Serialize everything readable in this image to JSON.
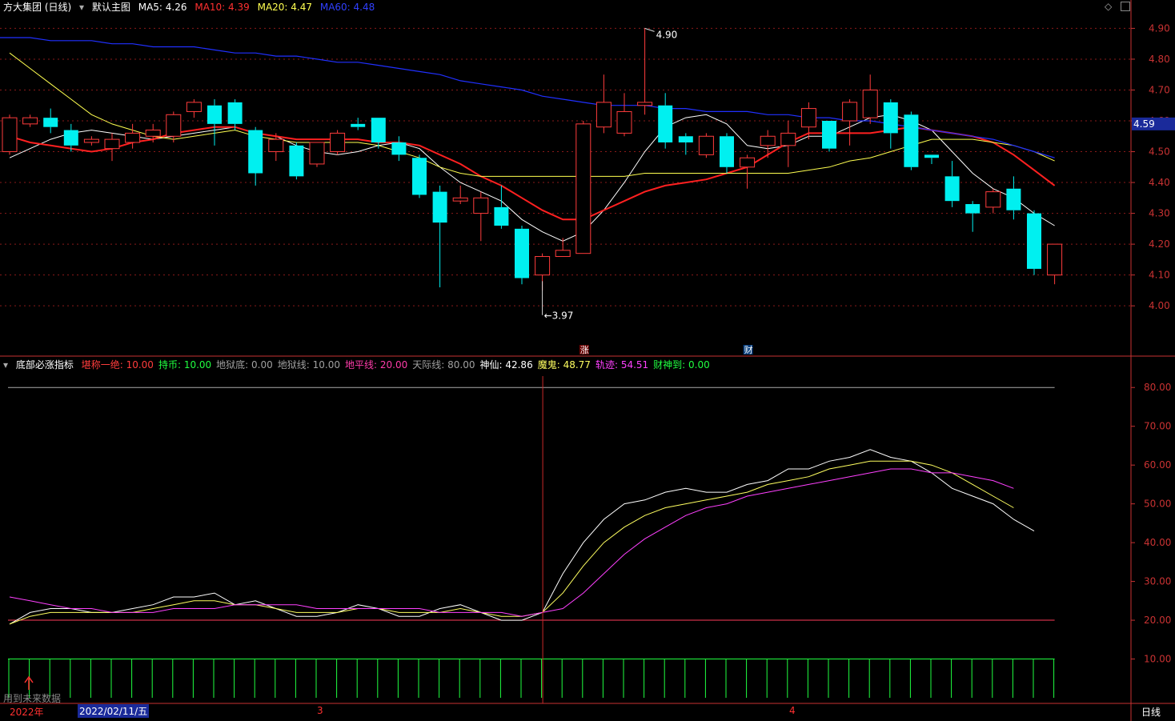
{
  "colors": {
    "bg": "#000000",
    "grid": "#8a1a1a",
    "axis_text": "#c83232",
    "up": "#ff3c3c",
    "down": "#00f0f0",
    "ma5": "#ffffff",
    "ma10": "#ff2020",
    "ma20": "#ffff50",
    "ma60": "#2030ff",
    "shenxian": "#ffffff",
    "mogui": "#ffff60",
    "guiji": "#ff40ff",
    "dipingxian": "#ff3c5a",
    "bars": "#20ff40"
  },
  "header": {
    "stock": "方大集团 (日线)",
    "main_chart": "默认主图",
    "ma5_label": "MA5:",
    "ma5_value": "4.26",
    "ma10_label": "MA10:",
    "ma10_value": "4.39",
    "ma20_label": "MA20:",
    "ma20_value": "4.47",
    "ma60_label": "MA60:",
    "ma60_value": "4.48",
    "icons": [
      "diamond-icon",
      "scroll-icon"
    ]
  },
  "indicator_header": {
    "name": "底部必涨指标",
    "items": [
      {
        "label": "堪称一绝:",
        "value": "10.00",
        "color": "#ff3c3c"
      },
      {
        "label": "持币:",
        "value": "10.00",
        "color": "#20ff40"
      },
      {
        "label": "地狱底:",
        "value": "0.00",
        "color": "#a0a0a0"
      },
      {
        "label": "地狱线:",
        "value": "10.00",
        "color": "#a0a0a0"
      },
      {
        "label": "地平线:",
        "value": "20.00",
        "color": "#ff3caa"
      },
      {
        "label": "天际线:",
        "value": "80.00",
        "color": "#a0a0a0"
      },
      {
        "label": "神仙:",
        "value": "42.86",
        "color": "#ffffff"
      },
      {
        "label": "魔鬼:",
        "value": "48.77",
        "color": "#ffff60"
      },
      {
        "label": "轨迹:",
        "value": "54.51",
        "color": "#ff40ff"
      },
      {
        "label": "财神到:",
        "value": "0.00",
        "color": "#20ff40"
      }
    ]
  },
  "annotations": {
    "high_label": "4.90",
    "low_label": "3.97",
    "current_price": "4.59",
    "zhang_marker": "涨",
    "cai_marker": "财",
    "future_data": "用到未来数据"
  },
  "date_axis": {
    "year": "2022年",
    "cursor_date": "2022/02/11/五",
    "month3": "3",
    "month4": "4",
    "period": "日线"
  },
  "chart_data": [
    {
      "type": "candlestick",
      "y_ticks": [
        "4.90",
        "4.80",
        "4.70",
        "4.60",
        "4.50",
        "4.40",
        "4.30",
        "4.20",
        "4.10",
        "4.00"
      ],
      "ylim": [
        3.92,
        4.94
      ],
      "candles": [
        [
          4.5,
          4.61,
          4.49,
          4.62
        ],
        [
          4.59,
          4.61,
          4.58,
          4.62
        ],
        [
          4.61,
          4.58,
          4.56,
          4.64
        ],
        [
          4.57,
          4.52,
          4.5,
          4.59
        ],
        [
          4.53,
          4.54,
          4.52,
          4.55
        ],
        [
          4.51,
          4.54,
          4.47,
          4.56
        ],
        [
          4.53,
          4.56,
          4.51,
          4.59
        ],
        [
          4.55,
          4.57,
          4.53,
          4.59
        ],
        [
          4.55,
          4.62,
          4.53,
          4.63
        ],
        [
          4.63,
          4.66,
          4.61,
          4.67
        ],
        [
          4.65,
          4.59,
          4.52,
          4.67
        ],
        [
          4.66,
          4.59,
          4.57,
          4.67
        ],
        [
          4.57,
          4.43,
          4.39,
          4.58
        ],
        [
          4.5,
          4.54,
          4.47,
          4.56
        ],
        [
          4.52,
          4.42,
          4.41,
          4.53
        ],
        [
          4.46,
          4.53,
          4.45,
          4.53
        ],
        [
          4.5,
          4.56,
          4.49,
          4.57
        ],
        [
          4.59,
          4.58,
          4.57,
          4.61
        ],
        [
          4.61,
          4.53,
          4.51,
          4.61
        ],
        [
          4.53,
          4.49,
          4.47,
          4.55
        ],
        [
          4.48,
          4.36,
          4.35,
          4.49
        ],
        [
          4.37,
          4.27,
          4.06,
          4.39
        ],
        [
          4.34,
          4.35,
          4.33,
          4.39
        ],
        [
          4.3,
          4.35,
          4.21,
          4.37
        ],
        [
          4.32,
          4.26,
          4.25,
          4.39
        ],
        [
          4.25,
          4.09,
          4.07,
          4.26
        ],
        [
          4.1,
          4.16,
          4.05,
          4.17
        ],
        [
          4.16,
          4.18,
          4.16,
          4.22
        ],
        [
          4.17,
          4.59,
          4.17,
          4.6
        ],
        [
          4.58,
          4.66,
          4.56,
          4.75
        ],
        [
          4.56,
          4.63,
          4.55,
          4.69
        ],
        [
          4.65,
          4.66,
          4.62,
          4.9
        ],
        [
          4.65,
          4.53,
          4.51,
          4.69
        ],
        [
          4.55,
          4.53,
          4.49,
          4.56
        ],
        [
          4.49,
          4.55,
          4.48,
          4.56
        ],
        [
          4.55,
          4.45,
          4.43,
          4.56
        ],
        [
          4.45,
          4.48,
          4.38,
          4.49
        ],
        [
          4.52,
          4.55,
          4.48,
          4.57
        ],
        [
          4.52,
          4.56,
          4.45,
          4.6
        ],
        [
          4.58,
          4.64,
          4.54,
          4.66
        ],
        [
          4.6,
          4.51,
          4.5,
          4.6
        ],
        [
          4.6,
          4.66,
          4.52,
          4.67
        ],
        [
          4.61,
          4.7,
          4.59,
          4.75
        ],
        [
          4.66,
          4.56,
          4.51,
          4.67
        ],
        [
          4.62,
          4.45,
          4.44,
          4.63
        ],
        [
          4.49,
          4.48,
          4.46,
          4.49
        ],
        [
          4.42,
          4.34,
          4.32,
          4.47
        ],
        [
          4.33,
          4.3,
          4.24,
          4.34
        ],
        [
          4.32,
          4.37,
          4.3,
          4.38
        ],
        [
          4.38,
          4.31,
          4.28,
          4.42
        ],
        [
          4.3,
          4.12,
          4.1,
          4.31
        ],
        [
          4.1,
          4.2,
          4.07,
          4.2
        ]
      ],
      "series": [
        {
          "name": "MA5",
          "values": [
            4.48,
            4.51,
            4.54,
            4.56,
            4.57,
            4.56,
            4.55,
            4.54,
            4.55,
            4.56,
            4.57,
            4.58,
            4.56,
            4.55,
            4.52,
            4.5,
            4.49,
            4.5,
            4.52,
            4.53,
            4.51,
            4.45,
            4.4,
            4.37,
            4.34,
            4.28,
            4.24,
            4.21,
            4.24,
            4.31,
            4.4,
            4.5,
            4.58,
            4.61,
            4.62,
            4.59,
            4.52,
            4.51,
            4.52,
            4.55,
            4.55,
            4.58,
            4.61,
            4.62,
            4.6,
            4.57,
            4.5,
            4.43,
            4.38,
            4.35,
            4.3,
            4.26
          ]
        },
        {
          "name": "MA10",
          "values": [
            4.55,
            4.53,
            4.52,
            4.51,
            4.5,
            4.51,
            4.53,
            4.54,
            4.56,
            4.57,
            4.58,
            4.58,
            4.56,
            4.55,
            4.54,
            4.54,
            4.54,
            4.54,
            4.53,
            4.53,
            4.52,
            4.49,
            4.46,
            4.42,
            4.39,
            4.35,
            4.31,
            4.28,
            4.28,
            4.31,
            4.34,
            4.37,
            4.39,
            4.4,
            4.41,
            4.43,
            4.45,
            4.49,
            4.53,
            4.56,
            4.56,
            4.56,
            4.56,
            4.57,
            4.58,
            4.57,
            4.56,
            4.55,
            4.53,
            4.49,
            4.44,
            4.39
          ]
        },
        {
          "name": "MA20",
          "values": [
            4.82,
            4.77,
            4.72,
            4.67,
            4.62,
            4.59,
            4.57,
            4.55,
            4.54,
            4.55,
            4.56,
            4.57,
            4.55,
            4.54,
            4.53,
            4.53,
            4.53,
            4.53,
            4.52,
            4.5,
            4.48,
            4.45,
            4.43,
            4.42,
            4.42,
            4.42,
            4.42,
            4.42,
            4.42,
            4.42,
            4.42,
            4.43,
            4.43,
            4.43,
            4.43,
            4.43,
            4.43,
            4.43,
            4.43,
            4.44,
            4.45,
            4.47,
            4.48,
            4.5,
            4.52,
            4.54,
            4.54,
            4.54,
            4.53,
            4.52,
            4.5,
            4.47
          ]
        },
        {
          "name": "MA60",
          "values": [
            4.87,
            4.87,
            4.86,
            4.86,
            4.86,
            4.85,
            4.85,
            4.84,
            4.84,
            4.84,
            4.83,
            4.82,
            4.82,
            4.81,
            4.81,
            4.8,
            4.79,
            4.79,
            4.78,
            4.77,
            4.76,
            4.75,
            4.73,
            4.72,
            4.71,
            4.7,
            4.68,
            4.67,
            4.66,
            4.65,
            4.65,
            4.65,
            4.64,
            4.64,
            4.63,
            4.63,
            4.63,
            4.62,
            4.62,
            4.61,
            4.61,
            4.6,
            4.6,
            4.59,
            4.58,
            4.57,
            4.56,
            4.55,
            4.54,
            4.52,
            4.5,
            4.48
          ]
        }
      ]
    },
    {
      "type": "line",
      "y_ticks": [
        "80.00",
        "70.00",
        "60.00",
        "50.00",
        "40.00",
        "30.00",
        "20.00",
        "10.00"
      ],
      "ylim": [
        0,
        85
      ],
      "horizontal_lines": [
        80,
        20
      ],
      "series": [
        {
          "name": "神仙",
          "values": [
            19,
            22,
            23,
            23,
            22,
            22,
            23,
            24,
            26,
            26,
            27,
            24,
            25,
            23,
            21,
            21,
            22,
            24,
            23,
            21,
            21,
            23,
            24,
            22,
            20,
            20,
            22,
            32,
            40,
            46,
            50,
            51,
            53,
            54,
            53,
            53,
            55,
            56,
            59,
            59,
            61,
            62,
            64,
            62,
            61,
            58,
            54,
            52,
            50,
            46,
            43
          ]
        },
        {
          "name": "魔鬼",
          "values": [
            19,
            21,
            22,
            22,
            22,
            22,
            22,
            23,
            24,
            25,
            25,
            24,
            24,
            23,
            22,
            22,
            22,
            23,
            23,
            22,
            22,
            22,
            23,
            22,
            21,
            21,
            22,
            27,
            34,
            40,
            44,
            47,
            49,
            50,
            51,
            52,
            53,
            55,
            56,
            57,
            59,
            60,
            61,
            61,
            61,
            60,
            58,
            55,
            52,
            49
          ]
        },
        {
          "name": "轨迹",
          "values": [
            26,
            25,
            24,
            23,
            23,
            22,
            22,
            22,
            23,
            23,
            23,
            24,
            24,
            24,
            24,
            23,
            23,
            23,
            23,
            23,
            23,
            22,
            22,
            22,
            22,
            21,
            22,
            23,
            27,
            32,
            37,
            41,
            44,
            47,
            49,
            50,
            52,
            53,
            54,
            55,
            56,
            57,
            58,
            59,
            59,
            58,
            58,
            57,
            56,
            54
          ]
        }
      ],
      "bar_values": [
        10,
        10,
        10,
        10,
        10,
        10,
        10,
        10,
        10,
        10,
        10,
        10,
        10,
        10,
        10,
        10,
        10,
        10,
        10,
        10,
        10,
        10,
        10,
        10,
        10,
        10,
        10,
        10,
        10,
        10,
        10,
        10,
        10,
        10,
        10,
        10,
        10,
        10,
        10,
        10,
        10,
        10,
        10,
        10,
        10,
        10,
        10,
        10,
        10,
        10,
        10,
        10
      ]
    }
  ]
}
